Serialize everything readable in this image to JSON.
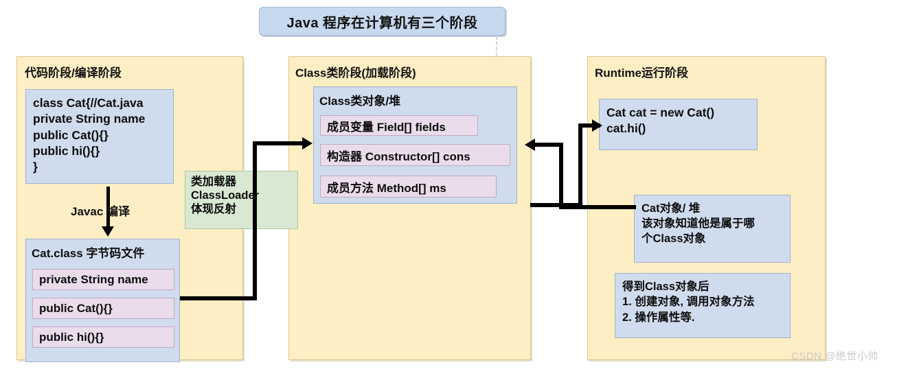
{
  "title": {
    "text": "Java 程序在计算机有三个阶段"
  },
  "stages": [
    {
      "id": "compile",
      "title": "代码阶段/编译阶段",
      "source_code": "class Cat{//Cat.java\nprivate String name\npublic Cat(){}\npublic hi(){}\n}",
      "compile_label": "Javac 编译",
      "bytecode_title": "Cat.class 字节码文件",
      "bytecode_members": [
        "private String name",
        "public Cat(){}",
        "public hi(){}"
      ]
    },
    {
      "id": "class",
      "title": "Class类阶段(加载阶段)",
      "class_object_title": "Class类对象/堆",
      "class_members": [
        "成员变量 Field[] fields",
        "构造器 Constructor[] cons",
        "成员方法 Method[] ms"
      ]
    },
    {
      "id": "runtime",
      "title": "Runtime运行阶段",
      "runtime_code": "Cat cat = new Cat()\ncat.hi()",
      "cat_object_note": "Cat对象/ 堆\n该对象知道他是属于哪\n个Class对象",
      "reflection_note": "得到Class对象后\n1. 创建对象, 调用对象方法\n2. 操作属性等."
    }
  ],
  "classloader": {
    "label": "类加载器\nClassLoader\n体现反射"
  },
  "watermark": {
    "text": "CSDN @绝世小帅"
  },
  "colors": {
    "stage_fill": "#fdeec4",
    "stage_border": "#d9c98d",
    "blue_fill": "#cfdcee",
    "blue_border": "#9fb2cc",
    "pink_fill": "#eadcea",
    "pink_border": "#c2a8c4",
    "green_fill": "#d9e8d2",
    "green_border": "#adc7a1",
    "title_fill": "#c6d9ee",
    "arrow": "#000000",
    "watermark": "#c9c9c9"
  }
}
